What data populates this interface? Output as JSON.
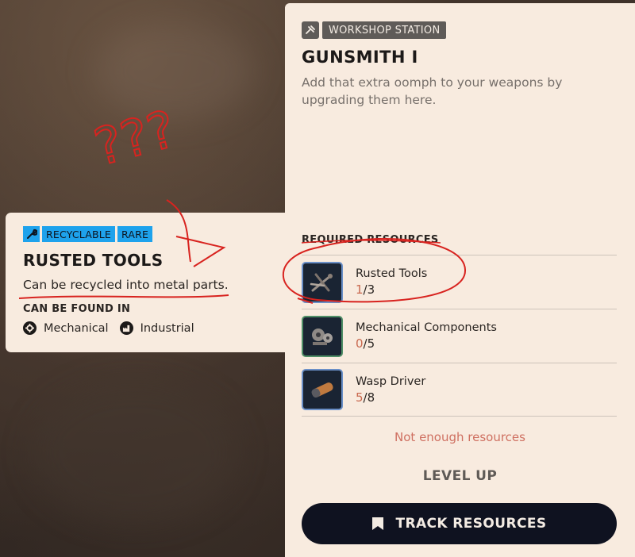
{
  "panel": {
    "station_label": "WORKSHOP STATION",
    "title": "GUNSMITH I",
    "description": "Add that extra oomph to your weapons by upgrading them here.",
    "required_title": "REQUIRED RESOURCES",
    "resources": [
      {
        "name": "Rusted Tools",
        "have": "1",
        "need": "/3",
        "icon": "rusted-tools-icon"
      },
      {
        "name": "Mechanical Components",
        "have": "0",
        "need": "/5",
        "icon": "mechanical-components-icon"
      },
      {
        "name": "Wasp Driver",
        "have": "5",
        "need": "/8",
        "icon": "wasp-driver-icon"
      }
    ],
    "warning": "Not enough resources",
    "level_up": "LEVEL UP",
    "track_button": "TRACK RESOURCES"
  },
  "tooltip": {
    "tags": [
      "RECYCLABLE",
      "RARE"
    ],
    "title": "RUSTED TOOLS",
    "description": "Can be recycled into metal parts.",
    "found_title": "CAN BE FOUND IN",
    "locations": [
      "Mechanical",
      "Industrial"
    ]
  },
  "colors": {
    "panel_bg": "#f8ebdf",
    "tag_blue": "#1ea2ec",
    "button_dark": "#0f1220",
    "warning": "#cf7061",
    "annotation_red": "#d8231f"
  },
  "annotation": {
    "question_marks": "???"
  }
}
